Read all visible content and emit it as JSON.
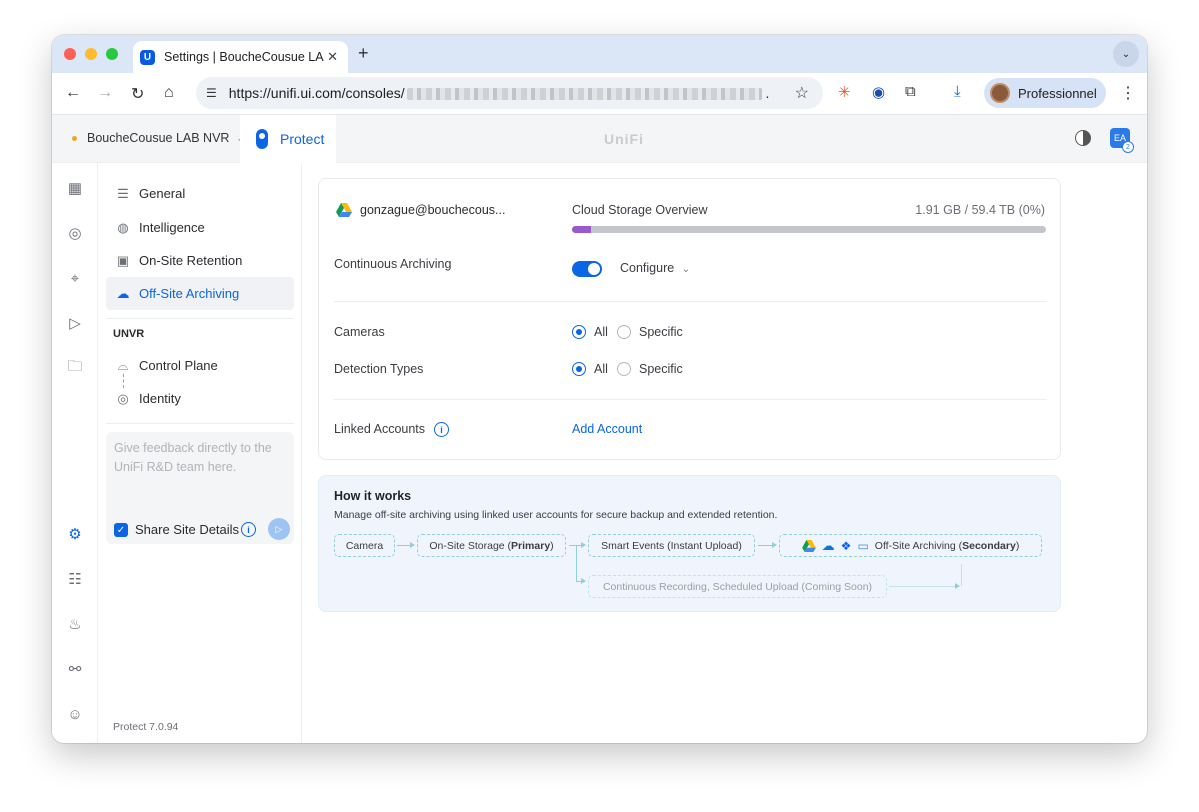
{
  "browser": {
    "tab_title": "Settings | BoucheCousue LAB NVR",
    "url_prefix": "https://unifi.ui.com/consoles/",
    "url_suffix": ".",
    "profile_name": "Professionnel"
  },
  "header": {
    "console_name": "BoucheCousue LAB NVR",
    "app_tab": "Protect",
    "brand": "UniFi",
    "ea_badge": "2",
    "ea_label": "EA"
  },
  "sidebar": {
    "items": [
      {
        "label": "General",
        "icon": "toggles-icon"
      },
      {
        "label": "Intelligence",
        "icon": "brain-icon"
      },
      {
        "label": "On-Site Retention",
        "icon": "storage-icon"
      },
      {
        "label": "Off-Site Archiving",
        "icon": "cloud-upload-icon",
        "active": true
      }
    ],
    "section_label": "UNVR",
    "section_items": [
      {
        "label": "Control Plane",
        "icon": "control-plane-icon"
      },
      {
        "label": "Identity",
        "icon": "fingerprint-icon"
      }
    ],
    "feedback_placeholder": "Give feedback directly to the UniFi R&D team here.",
    "share_label": "Share Site Details",
    "version": "Protect 7.0.94"
  },
  "main": {
    "account_email": "gonzague@bouchecous...",
    "storage_title": "Cloud Storage Overview",
    "storage_usage": "1.91 GB / 59.4 TB (0%)",
    "storage_fill_fraction": 0.04,
    "continuous_archiving_label": "Continuous Archiving",
    "continuous_archiving_on": true,
    "configure_label": "Configure",
    "cameras_label": "Cameras",
    "detection_label": "Detection Types",
    "opt_all": "All",
    "opt_specific": "Specific",
    "linked_accounts_label": "Linked Accounts",
    "add_account_label": "Add Account"
  },
  "how_it_works": {
    "title": "How it works",
    "description": "Manage off-site archiving using linked user accounts for secure backup and extended retention.",
    "camera": "Camera",
    "onsite_prefix": "On-Site Storage (",
    "onsite_bold": "Primary",
    "onsite_suffix": ")",
    "smart_events": "Smart Events (Instant Upload)",
    "offsite_prefix": "Off-Site Archiving (",
    "offsite_bold": "Secondary",
    "offsite_suffix": ")",
    "continuous": "Continuous Recording, Scheduled Upload (Coming Soon)"
  },
  "colors": {
    "accent": "#0a66e4",
    "storage_bar": "#9b59d0",
    "flow_border": "#8fd0d6"
  }
}
